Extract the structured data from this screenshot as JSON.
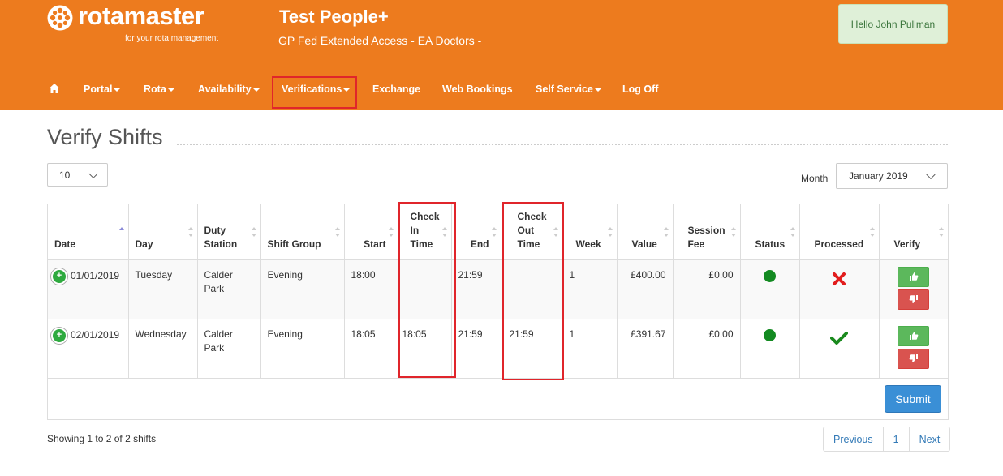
{
  "brand": {
    "name": "rotamaster",
    "tagline": "for your rota management",
    "color": "#ed7b1e"
  },
  "header": {
    "title": "Test People+",
    "subtitle": "GP Fed Extended Access - EA Doctors -",
    "greeting": "Hello John Pullman"
  },
  "nav": {
    "home_icon": "home-icon",
    "items": [
      {
        "label": "Portal",
        "dropdown": true
      },
      {
        "label": "Rota",
        "dropdown": true
      },
      {
        "label": "Availability",
        "dropdown": true
      },
      {
        "label": "Verifications",
        "dropdown": true
      },
      {
        "label": "Exchange",
        "dropdown": false
      },
      {
        "label": "Web Bookings",
        "dropdown": false
      },
      {
        "label": "Self Service",
        "dropdown": true
      },
      {
        "label": "Log Off",
        "dropdown": false
      }
    ]
  },
  "page": {
    "title": "Verify Shifts",
    "page_size": "10",
    "month_label": "Month",
    "month_value": "January 2019"
  },
  "table": {
    "headers": {
      "date": "Date",
      "day": "Day",
      "duty_station": "Duty Station",
      "shift_group": "Shift Group",
      "start": "Start",
      "check_in": "Check In Time",
      "end": "End",
      "check_out": "Check Out Time",
      "week": "Week",
      "value": "Value",
      "session_fee": "Session Fee",
      "status": "Status",
      "processed": "Processed",
      "verify": "Verify"
    },
    "rows": [
      {
        "date": "01/01/2019",
        "day": "Tuesday",
        "duty_station": "Calder Park",
        "shift_group": "Evening",
        "start": "18:00",
        "check_in": "",
        "end": "21:59",
        "check_out": "",
        "week": "1",
        "value": "£400.00",
        "session_fee": "£0.00",
        "status_color": "#138a21",
        "processed": "cross-icon"
      },
      {
        "date": "02/01/2019",
        "day": "Wednesday",
        "duty_station": "Calder Park",
        "shift_group": "Evening",
        "start": "18:05",
        "check_in": "18:05",
        "end": "21:59",
        "check_out": "21:59",
        "week": "1",
        "value": "£391.67",
        "session_fee": "£0.00",
        "status_color": "#138a21",
        "processed": "check-icon"
      }
    ]
  },
  "actions": {
    "submit_label": "Submit"
  },
  "footer": {
    "showing": "Showing 1 to 2 of 2 shifts",
    "pager": {
      "previous": "Previous",
      "current": "1",
      "next": "Next"
    }
  }
}
